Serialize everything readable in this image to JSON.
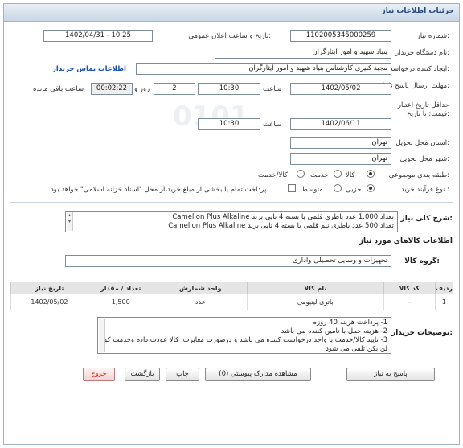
{
  "header": {
    "title": "جزئیات اطلاعات نیاز"
  },
  "form": {
    "need_number_label": "شماره نیاز:",
    "need_number": "1102005345000259",
    "announce_label": "تاریخ و ساعت اعلان عمومی:",
    "announce_value": "1402/04/31 - 10:25",
    "buyer_org_label": "نام دستگاه خریدار:",
    "buyer_org": "بنیاد شهید و امور ایثارگران",
    "creator_label": "ایجاد کننده درخواست:",
    "creator": "مجید کبیری کارشناس بنیاد شهید و امور ایثارگران",
    "contact_link": "اطلاعات تماس خریدار",
    "deadline_label": "مهلت ارسال پاسخ تا تاریخ:",
    "deadline_date": "1402/05/02",
    "time_label": "ساعت",
    "deadline_time": "10:30",
    "days_value": "2",
    "days_label": "روز و",
    "remaining_value": "00:02:22",
    "remaining_label": "ساعت باقی مانده",
    "validity_label": "حداقل تاریخ اعتبار قیمت: تا تاریخ:",
    "validity_date": "1402/06/11",
    "validity_time_label": "ساعت",
    "validity_time": "10:30",
    "province_label": "استان محل تحویل:",
    "province": "تهران",
    "city_label": "شهر محل تحویل:",
    "city": "تهران",
    "category_label": "طبقه بندی موضوعی:",
    "category_options": [
      "کالا",
      "خدمت",
      "کالا/خدمت"
    ],
    "process_label": "نوع فرآیند خرید :",
    "process_options": [
      "جزیی",
      "متوسط"
    ],
    "payment_note": "پرداخت تمام یا بخشی از مبلغ خرید،از محل \"اسناد خزانه اسلامی\" خواهد بود."
  },
  "summary": {
    "label": "شرح کلی نیاز:",
    "line1": "تعداد 1.000 عدد باطری قلمی با بسته 4 تایی برند Camelion Plus Alkaline",
    "line2": "تعداد 500 عدد باطری نیم قلمی با بسته 4 تایی برند Camelion Plus Alkaline"
  },
  "goods": {
    "section_title": "اطلاعات کالاهای مورد نیاز",
    "group_label": "گروه کالا:",
    "group_value": "تجهیزات و وسایل تحصیلی واداری",
    "columns": [
      "ردیف",
      "کد کالا",
      "نام کالا",
      "واحد شمارش",
      "تعداد / مقدار",
      "تاریخ نیاز"
    ],
    "rows": [
      {
        "index": "1",
        "code": "--",
        "name": "باتری لیتیومی",
        "unit": "عدد",
        "qty": "1,500",
        "date": "1402/05/02"
      }
    ]
  },
  "notes": {
    "label": "توضیحات خریدار:",
    "line1": "1- پرداخت هزینه 40 روزه",
    "line2": "2- هزینه حمل با تامین کننده می باشد",
    "line3": "3- تایید کالا/خدمت با واحد درخواست کننده می باشد و درصورت مغایرت، کالا عودت داده وخدمت کم",
    "line4": "لن یکن تلقی می شود"
  },
  "buttons": {
    "reply": "پاسخ به نیاز",
    "attachments": "مشاهده مدارک پیوستی (0)",
    "print": "چاپ",
    "back": "بازگشت",
    "exit": "خروج"
  },
  "colors": {
    "accent": "#1a4fb8",
    "header_bg": "#c9d7e6",
    "danger": "#c0392b"
  }
}
